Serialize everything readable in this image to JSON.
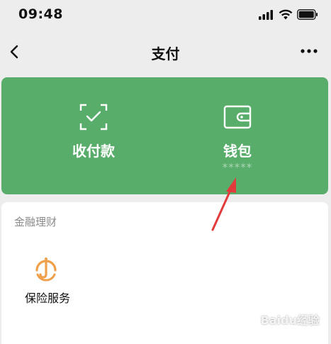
{
  "status_bar": {
    "time": "09:48"
  },
  "nav": {
    "title": "支付"
  },
  "card": {
    "left": {
      "label": "收付款",
      "icon": "scan-check-icon"
    },
    "right": {
      "label": "钱包",
      "sub": "*****",
      "icon": "wallet-icon"
    },
    "color": "#59ad6b"
  },
  "section": {
    "title": "金融理财",
    "items": [
      {
        "label": "保险服务",
        "icon": "insurance-umbrella-icon"
      }
    ]
  },
  "annotation": {
    "color": "#e33b3b"
  },
  "watermark": {
    "text": "Baidu经验"
  }
}
